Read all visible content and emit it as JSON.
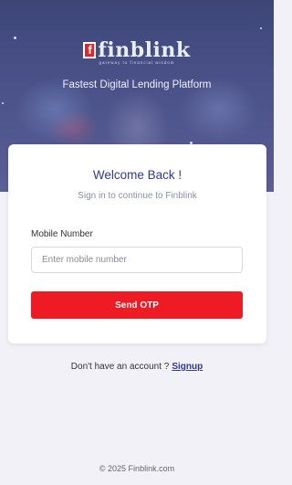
{
  "brand": {
    "logo_text": "finblink",
    "tagline": "gateway to financial wisdom",
    "hero_title": "Fastest Digital Lending Platform"
  },
  "login_card": {
    "title": "Welcome Back !",
    "subtitle": "Sign in to continue to Finblink",
    "mobile_label": "Mobile Number",
    "mobile_value": "",
    "mobile_placeholder": "Enter mobile number",
    "send_otp_label": "Send OTP"
  },
  "signup": {
    "prompt": "Don't have an account ?",
    "link_label": "Signup"
  },
  "footer": {
    "copyright": "© 2025 Finblink.com"
  },
  "colors": {
    "accent_red": "#ee1b24",
    "brand_blue": "#2f3b8a",
    "hero_bg": "#4a5289"
  }
}
